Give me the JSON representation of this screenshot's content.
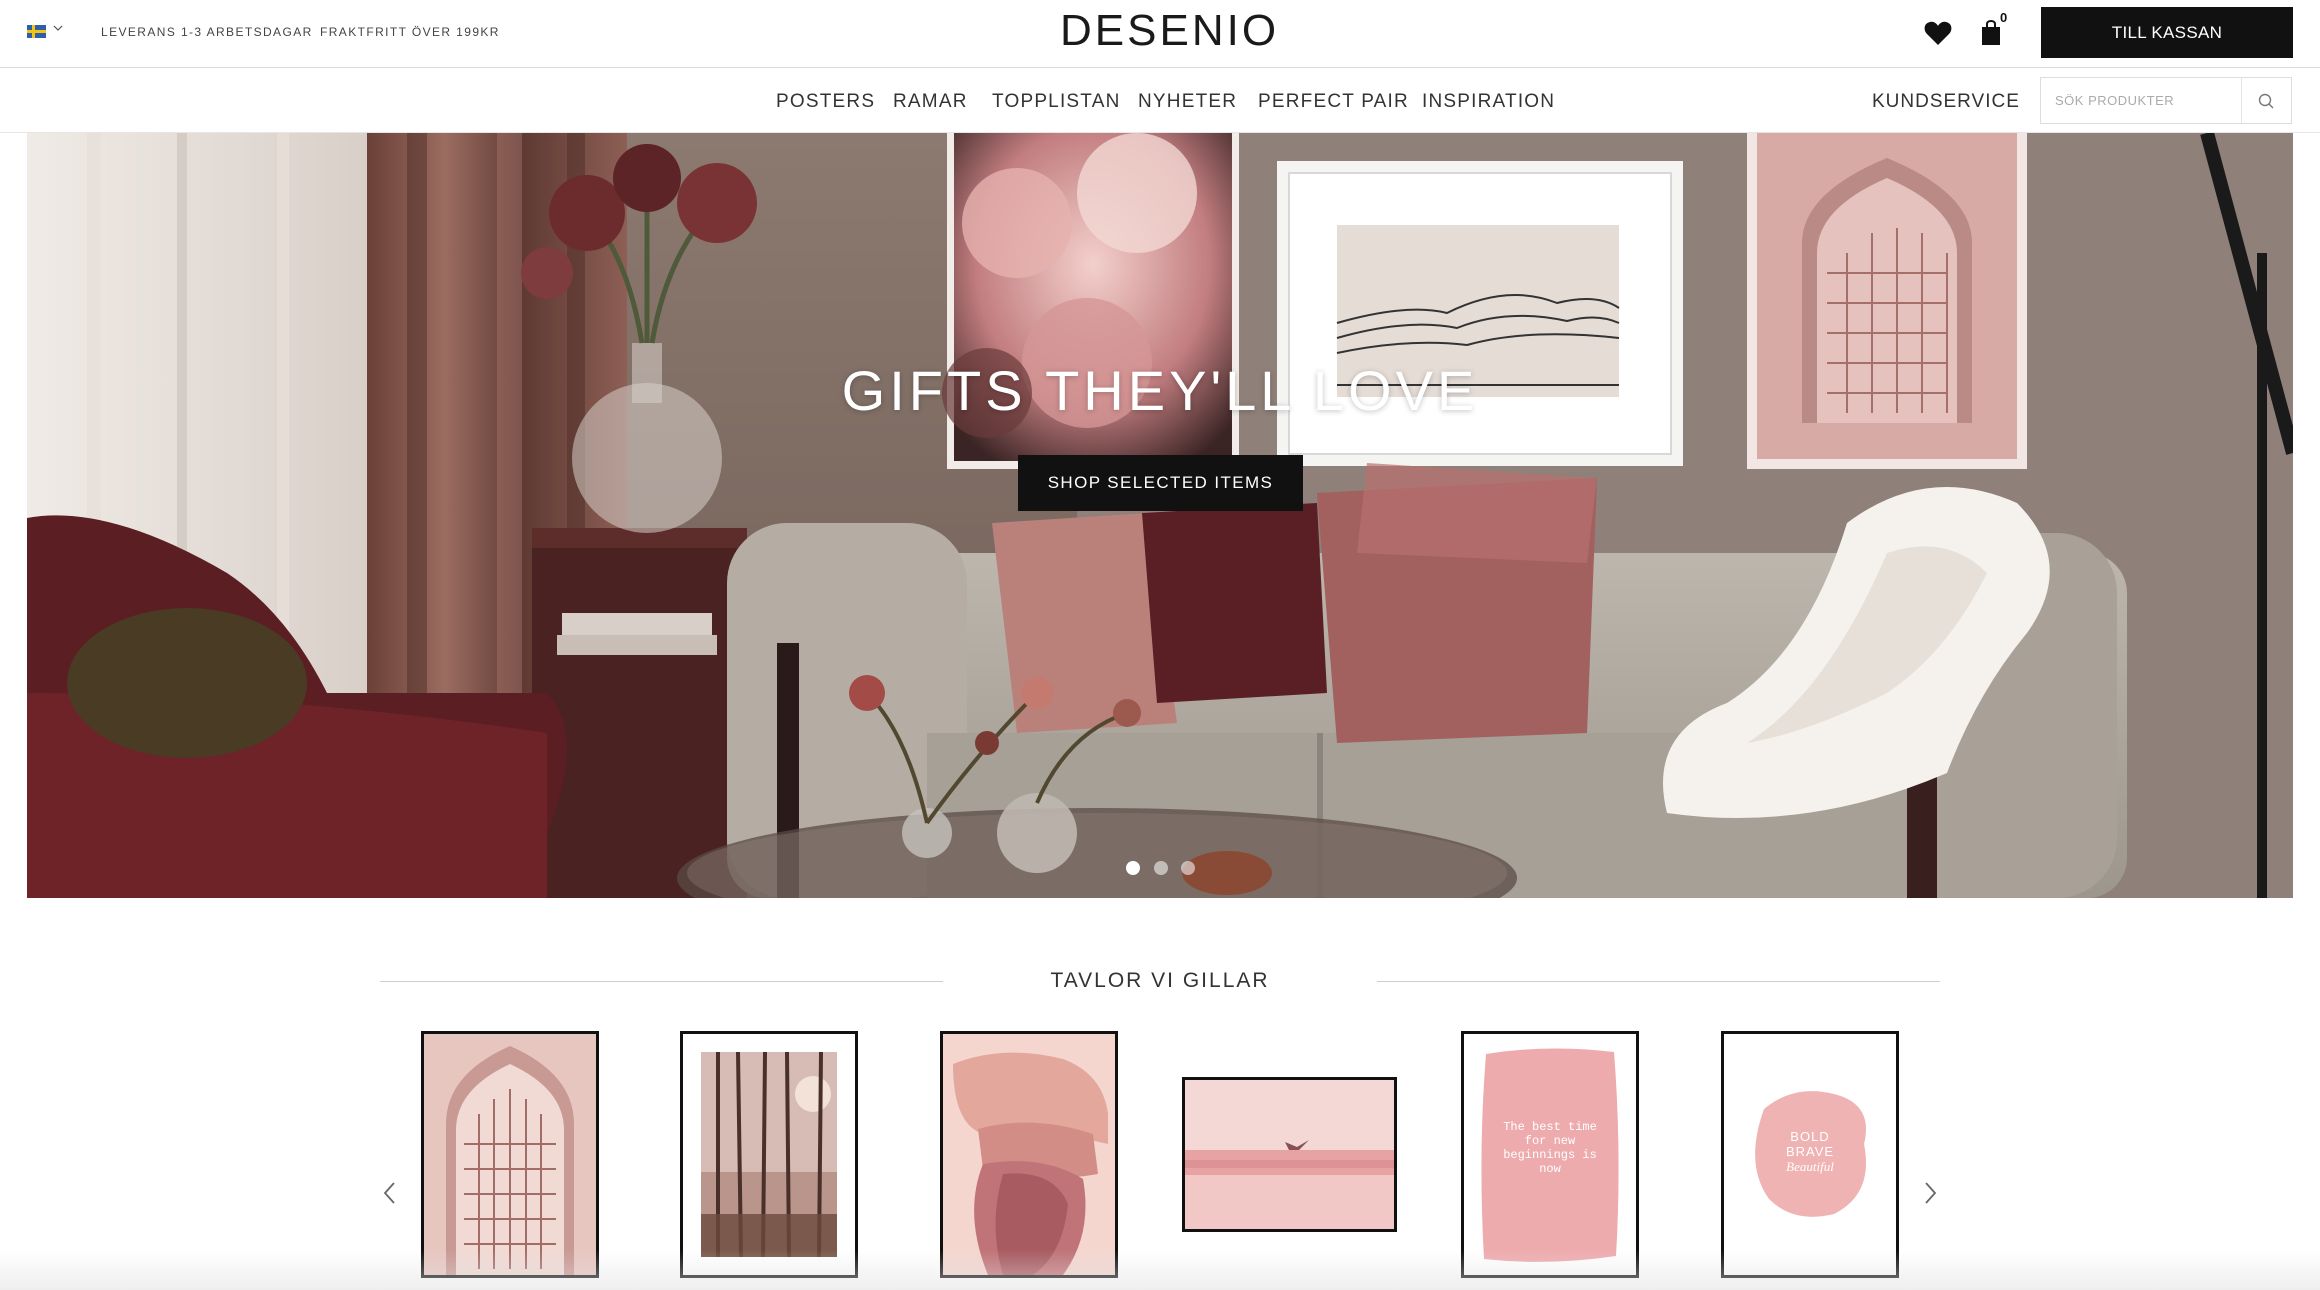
{
  "topbar": {
    "language": "sv-flag-icon",
    "delivery": "LEVERANS 1-3 ARBETSDAGAR",
    "shipping": "FRAKTFRITT ÖVER 199KR",
    "logo": "DESENIO",
    "cart_count": "0",
    "checkout_label": "TILL KASSAN"
  },
  "nav": {
    "items": [
      "POSTERS",
      "RAMAR",
      "TOPPLISTAN",
      "NYHETER",
      "PERFECT PAIR",
      "INSPIRATION"
    ],
    "service": "KUNDSERVICE",
    "search_placeholder": "SÖK PRODUKTER"
  },
  "hero": {
    "title": "GIFTS THEY'LL LOVE",
    "cta": "SHOP SELECTED ITEMS",
    "slide_count": 3,
    "active_slide": 1
  },
  "section": {
    "title": "TAVLOR VI GILLAR",
    "products": [
      {
        "name": "moroccan-arch-poster"
      },
      {
        "name": "misty-forest-poster"
      },
      {
        "name": "pink-watercolor-poster"
      },
      {
        "name": "pink-landscape-bird-poster"
      },
      {
        "name": "quote-poster",
        "text": "The best time for new beginnings is now"
      },
      {
        "name": "bold-brave-poster",
        "line1": "BOLD",
        "line2": "BRAVE",
        "line3": "Beautiful"
      }
    ]
  },
  "colors": {
    "accent": "#111111",
    "pink": "#e8a8a8"
  }
}
